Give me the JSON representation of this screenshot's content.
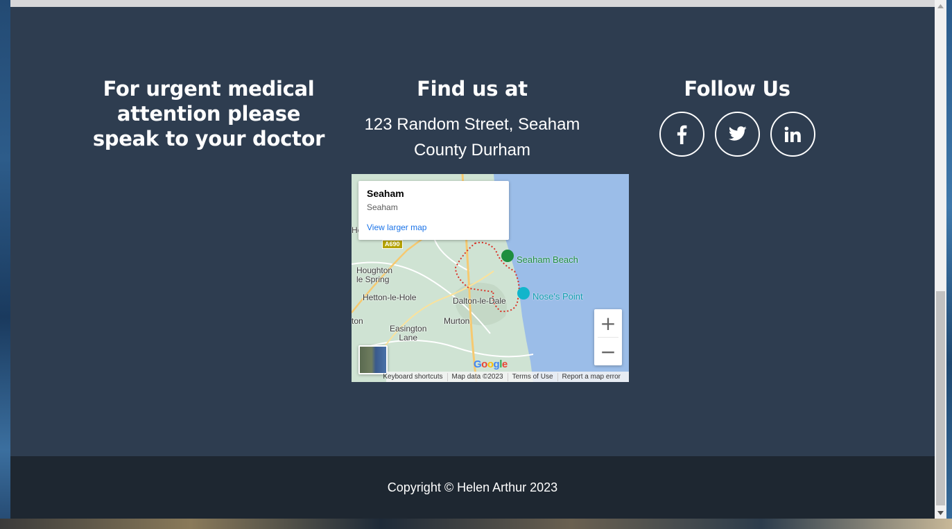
{
  "footer": {
    "urgent": {
      "heading": "For urgent medical attention please speak to your doctor"
    },
    "find": {
      "heading": "Find us at",
      "address_line1": "123 Random Street, Seaham",
      "address_line2": "County Durham"
    },
    "follow": {
      "heading": "Follow Us",
      "socials": [
        {
          "icon": "facebook-icon",
          "label": "Facebook"
        },
        {
          "icon": "twitter-icon",
          "label": "Twitter"
        },
        {
          "icon": "linkedin-icon",
          "label": "LinkedIn"
        }
      ]
    },
    "copyright": "Copyright © Helen Arthur 2023"
  },
  "map": {
    "info_card": {
      "title": "Seaham",
      "subtitle": "Seaham",
      "link": "View larger map"
    },
    "road_badge": "A690",
    "place_labels": {
      "houghton": "Houghton\nle Spring",
      "hetton": "Hetton-le-Hole",
      "dalton": "Dalton-le-Dale",
      "murton": "Murton",
      "easington": "Easington\nLane",
      "he": "He",
      "ton": "ton"
    },
    "pois": {
      "beach": "Seaham Beach",
      "point": "Nose's Point"
    },
    "zoom_in": "+",
    "zoom_out": "−",
    "logo": "Google",
    "attribution": {
      "shortcuts": "Keyboard shortcuts",
      "data": "Map data ©2023",
      "terms": "Terms of Use",
      "report": "Report a map error"
    }
  },
  "colors": {
    "footer_bg": "#2e3d50",
    "footer_bottom_bg": "#1e2731",
    "sea": "#9bbde8",
    "land": "#cfe3d3",
    "link": "#1a73e8"
  }
}
